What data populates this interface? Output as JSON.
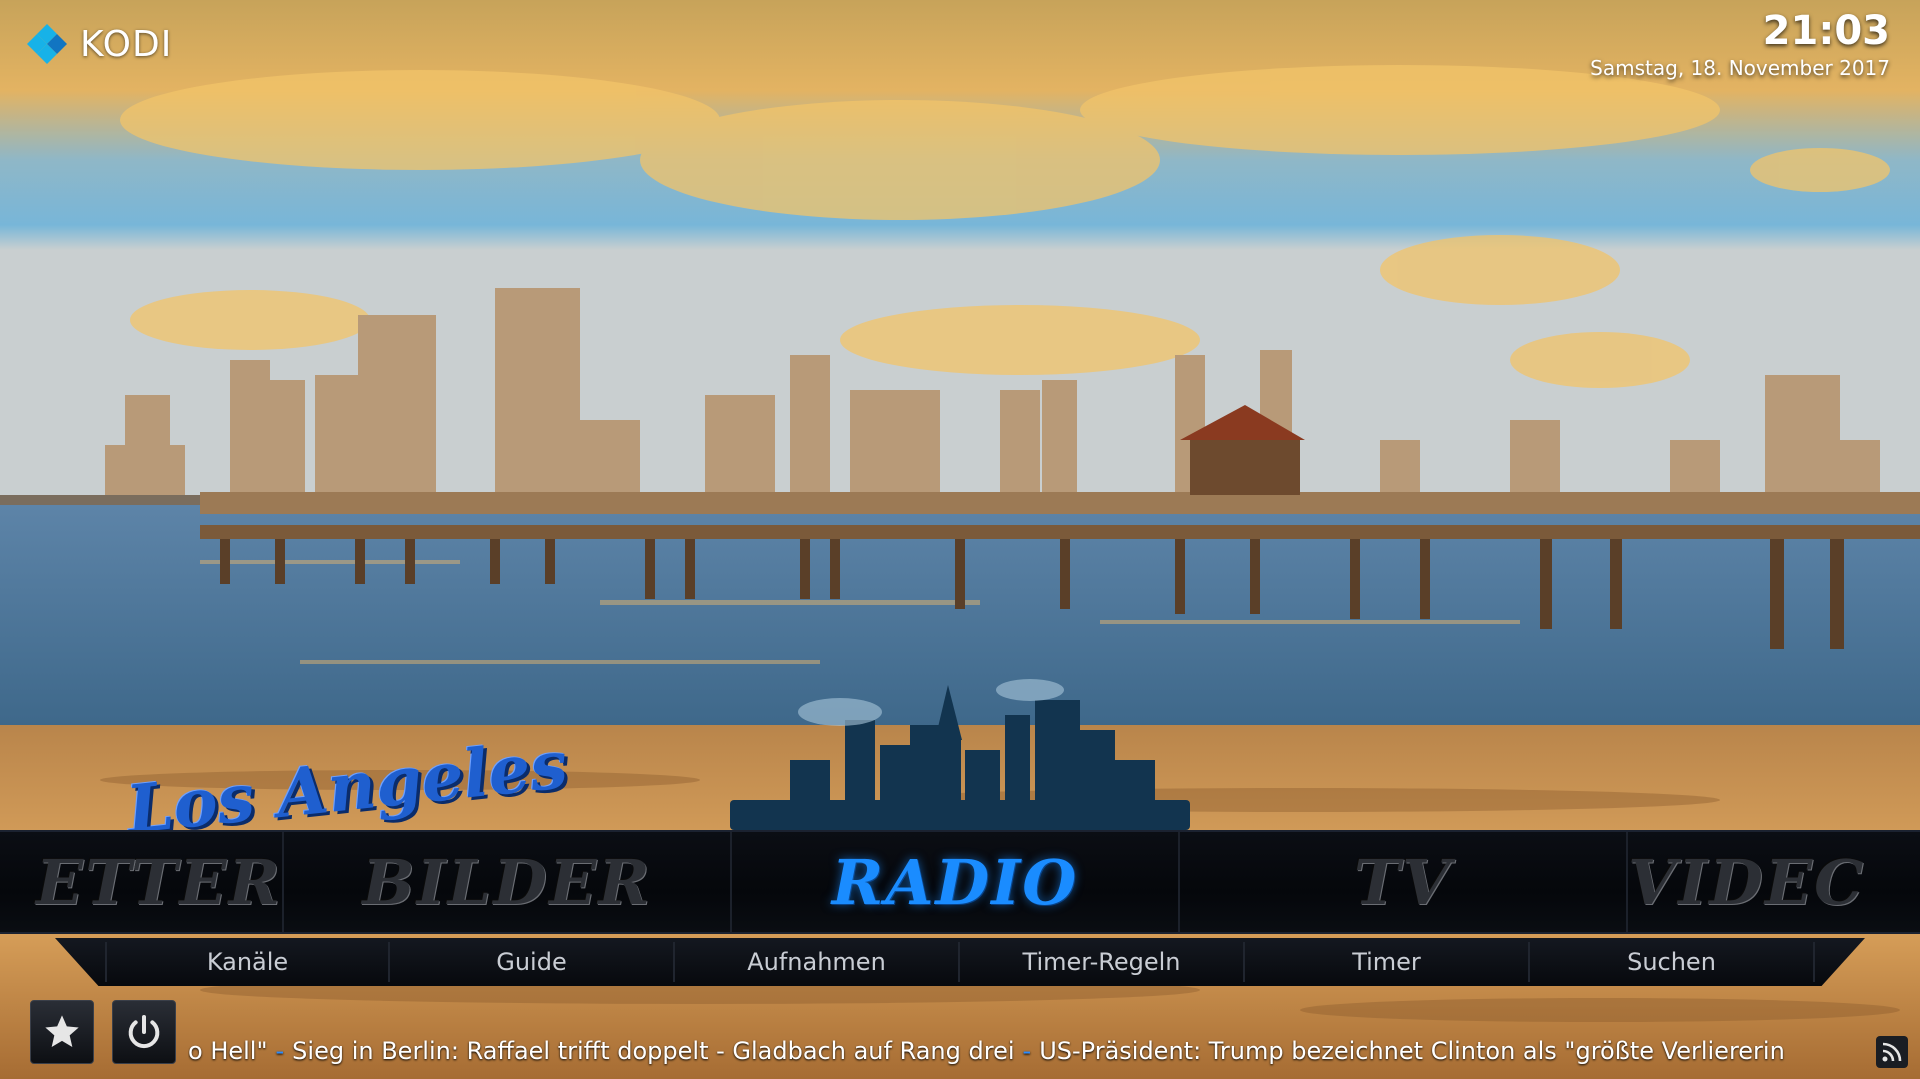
{
  "app": {
    "name": "KODI"
  },
  "clock": {
    "time": "21:03",
    "date": "Samstag, 18. November 2017"
  },
  "emblem": {
    "text": "Los Angeles"
  },
  "main_menu": {
    "items": [
      {
        "label": "WETTER",
        "visible": "ETTER"
      },
      {
        "label": "BILDER"
      },
      {
        "label": "RADIO",
        "active": true
      },
      {
        "label": "TV"
      },
      {
        "label": "VIDEOS",
        "visible": "VIDEC"
      }
    ]
  },
  "sub_menu": {
    "items": [
      "Kanäle",
      "Guide",
      "Aufnahmen",
      "Timer-Regeln",
      "Timer",
      "Suchen"
    ]
  },
  "bottom": {
    "favourites_icon": "star-icon",
    "power_icon": "power-icon",
    "rss_icon": "rss-icon"
  },
  "ticker": {
    "items": [
      "o Hell\"",
      "Sieg in Berlin: Raffael trifft doppelt - Gladbach auf Rang drei",
      "US-Präsident: Trump bezeichnet Clinton als \"größte Verliererin"
    ]
  },
  "colors": {
    "accent": "#1a8cff",
    "menu_bg": "#05070b"
  }
}
